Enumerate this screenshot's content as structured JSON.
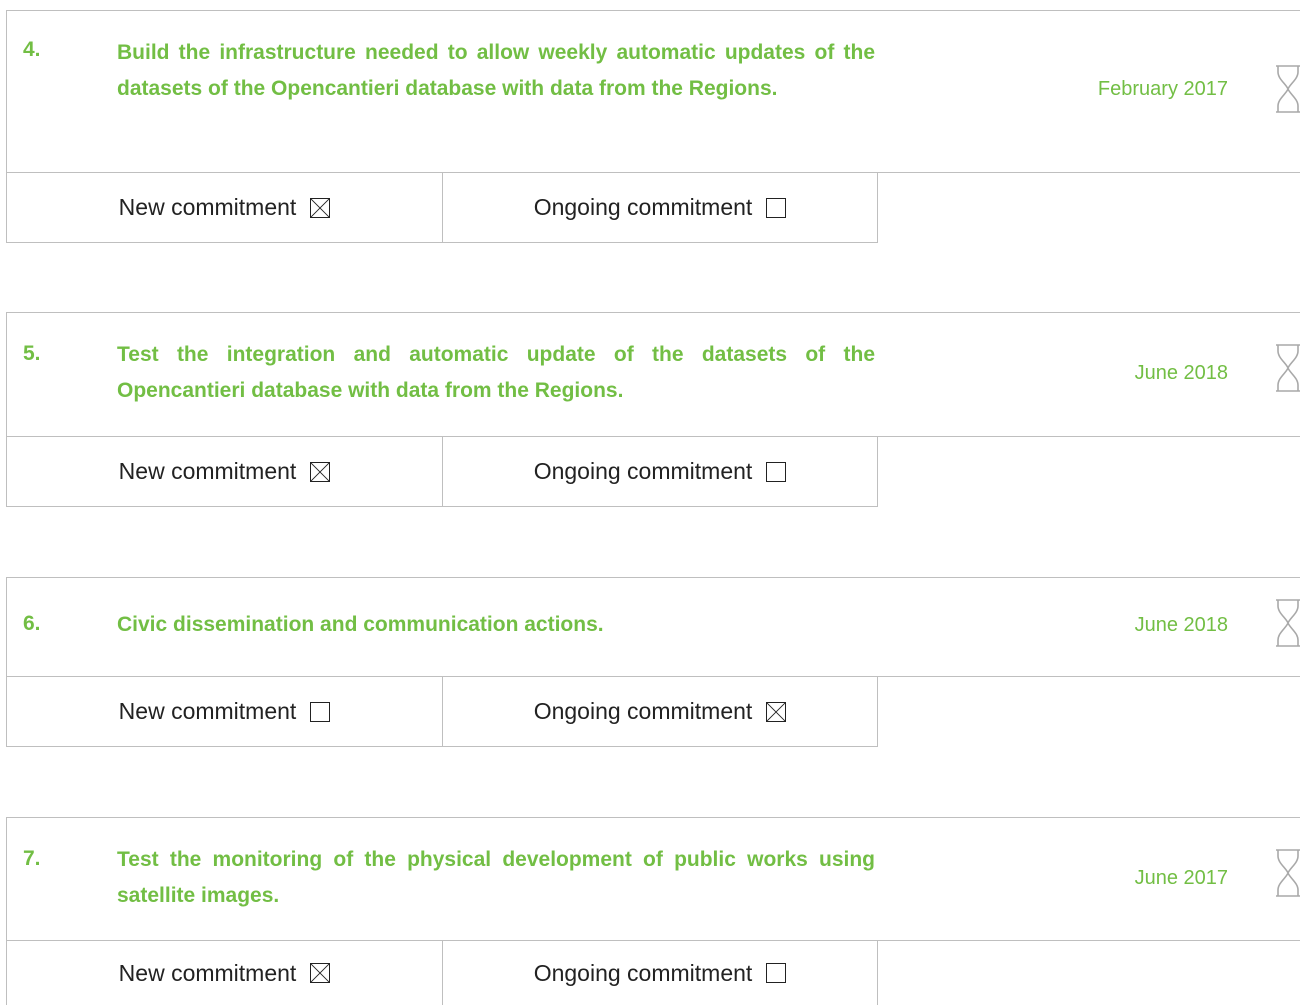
{
  "labels": {
    "new": "New commitment",
    "ongoing": "Ongoing commitment"
  },
  "milestones": [
    {
      "number": "4.",
      "title": "Build the infrastructure needed to allow weekly automatic updates of the datasets of the Opencantieri database with data from the Regions.",
      "date": "February 2017",
      "new_checked": true,
      "ongoing_checked": false
    },
    {
      "number": "5.",
      "title": "Test the integration and automatic update of the datasets of the Opencantieri database with data from the Regions.",
      "date": "June 2018",
      "new_checked": true,
      "ongoing_checked": false
    },
    {
      "number": "6.",
      "title": "Civic dissemination and communication actions.",
      "date": "June 2018",
      "new_checked": false,
      "ongoing_checked": true
    },
    {
      "number": "7.",
      "title": "Test the monitoring of the physical development of public works using satellite images.",
      "date": "June 2017",
      "new_checked": true,
      "ongoing_checked": false
    }
  ],
  "icons": {
    "status": "hourglass-icon",
    "checked": "checked-box",
    "unchecked": "empty-box"
  },
  "colors": {
    "accent": "#72be44",
    "border": "#bfbfbf",
    "text": "#222222"
  }
}
